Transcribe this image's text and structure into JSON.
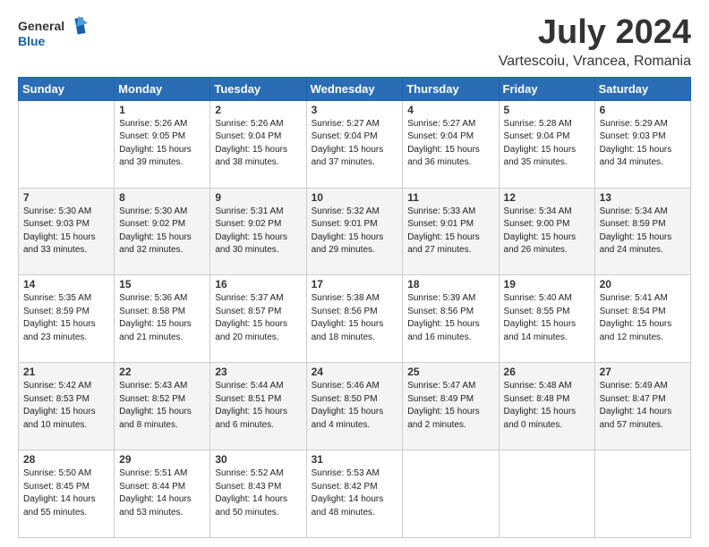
{
  "header": {
    "logo_line1": "General",
    "logo_line2": "Blue",
    "month": "July 2024",
    "location": "Vartescoiu, Vrancea, Romania"
  },
  "days_of_week": [
    "Sunday",
    "Monday",
    "Tuesday",
    "Wednesday",
    "Thursday",
    "Friday",
    "Saturday"
  ],
  "weeks": [
    [
      {
        "day": "",
        "info": ""
      },
      {
        "day": "1",
        "info": "Sunrise: 5:26 AM\nSunset: 9:05 PM\nDaylight: 15 hours\nand 39 minutes."
      },
      {
        "day": "2",
        "info": "Sunrise: 5:26 AM\nSunset: 9:04 PM\nDaylight: 15 hours\nand 38 minutes."
      },
      {
        "day": "3",
        "info": "Sunrise: 5:27 AM\nSunset: 9:04 PM\nDaylight: 15 hours\nand 37 minutes."
      },
      {
        "day": "4",
        "info": "Sunrise: 5:27 AM\nSunset: 9:04 PM\nDaylight: 15 hours\nand 36 minutes."
      },
      {
        "day": "5",
        "info": "Sunrise: 5:28 AM\nSunset: 9:04 PM\nDaylight: 15 hours\nand 35 minutes."
      },
      {
        "day": "6",
        "info": "Sunrise: 5:29 AM\nSunset: 9:03 PM\nDaylight: 15 hours\nand 34 minutes."
      }
    ],
    [
      {
        "day": "7",
        "info": "Sunrise: 5:30 AM\nSunset: 9:03 PM\nDaylight: 15 hours\nand 33 minutes."
      },
      {
        "day": "8",
        "info": "Sunrise: 5:30 AM\nSunset: 9:02 PM\nDaylight: 15 hours\nand 32 minutes."
      },
      {
        "day": "9",
        "info": "Sunrise: 5:31 AM\nSunset: 9:02 PM\nDaylight: 15 hours\nand 30 minutes."
      },
      {
        "day": "10",
        "info": "Sunrise: 5:32 AM\nSunset: 9:01 PM\nDaylight: 15 hours\nand 29 minutes."
      },
      {
        "day": "11",
        "info": "Sunrise: 5:33 AM\nSunset: 9:01 PM\nDaylight: 15 hours\nand 27 minutes."
      },
      {
        "day": "12",
        "info": "Sunrise: 5:34 AM\nSunset: 9:00 PM\nDaylight: 15 hours\nand 26 minutes."
      },
      {
        "day": "13",
        "info": "Sunrise: 5:34 AM\nSunset: 8:59 PM\nDaylight: 15 hours\nand 24 minutes."
      }
    ],
    [
      {
        "day": "14",
        "info": "Sunrise: 5:35 AM\nSunset: 8:59 PM\nDaylight: 15 hours\nand 23 minutes."
      },
      {
        "day": "15",
        "info": "Sunrise: 5:36 AM\nSunset: 8:58 PM\nDaylight: 15 hours\nand 21 minutes."
      },
      {
        "day": "16",
        "info": "Sunrise: 5:37 AM\nSunset: 8:57 PM\nDaylight: 15 hours\nand 20 minutes."
      },
      {
        "day": "17",
        "info": "Sunrise: 5:38 AM\nSunset: 8:56 PM\nDaylight: 15 hours\nand 18 minutes."
      },
      {
        "day": "18",
        "info": "Sunrise: 5:39 AM\nSunset: 8:56 PM\nDaylight: 15 hours\nand 16 minutes."
      },
      {
        "day": "19",
        "info": "Sunrise: 5:40 AM\nSunset: 8:55 PM\nDaylight: 15 hours\nand 14 minutes."
      },
      {
        "day": "20",
        "info": "Sunrise: 5:41 AM\nSunset: 8:54 PM\nDaylight: 15 hours\nand 12 minutes."
      }
    ],
    [
      {
        "day": "21",
        "info": "Sunrise: 5:42 AM\nSunset: 8:53 PM\nDaylight: 15 hours\nand 10 minutes."
      },
      {
        "day": "22",
        "info": "Sunrise: 5:43 AM\nSunset: 8:52 PM\nDaylight: 15 hours\nand 8 minutes."
      },
      {
        "day": "23",
        "info": "Sunrise: 5:44 AM\nSunset: 8:51 PM\nDaylight: 15 hours\nand 6 minutes."
      },
      {
        "day": "24",
        "info": "Sunrise: 5:46 AM\nSunset: 8:50 PM\nDaylight: 15 hours\nand 4 minutes."
      },
      {
        "day": "25",
        "info": "Sunrise: 5:47 AM\nSunset: 8:49 PM\nDaylight: 15 hours\nand 2 minutes."
      },
      {
        "day": "26",
        "info": "Sunrise: 5:48 AM\nSunset: 8:48 PM\nDaylight: 15 hours\nand 0 minutes."
      },
      {
        "day": "27",
        "info": "Sunrise: 5:49 AM\nSunset: 8:47 PM\nDaylight: 14 hours\nand 57 minutes."
      }
    ],
    [
      {
        "day": "28",
        "info": "Sunrise: 5:50 AM\nSunset: 8:45 PM\nDaylight: 14 hours\nand 55 minutes."
      },
      {
        "day": "29",
        "info": "Sunrise: 5:51 AM\nSunset: 8:44 PM\nDaylight: 14 hours\nand 53 minutes."
      },
      {
        "day": "30",
        "info": "Sunrise: 5:52 AM\nSunset: 8:43 PM\nDaylight: 14 hours\nand 50 minutes."
      },
      {
        "day": "31",
        "info": "Sunrise: 5:53 AM\nSunset: 8:42 PM\nDaylight: 14 hours\nand 48 minutes."
      },
      {
        "day": "",
        "info": ""
      },
      {
        "day": "",
        "info": ""
      },
      {
        "day": "",
        "info": ""
      }
    ]
  ]
}
